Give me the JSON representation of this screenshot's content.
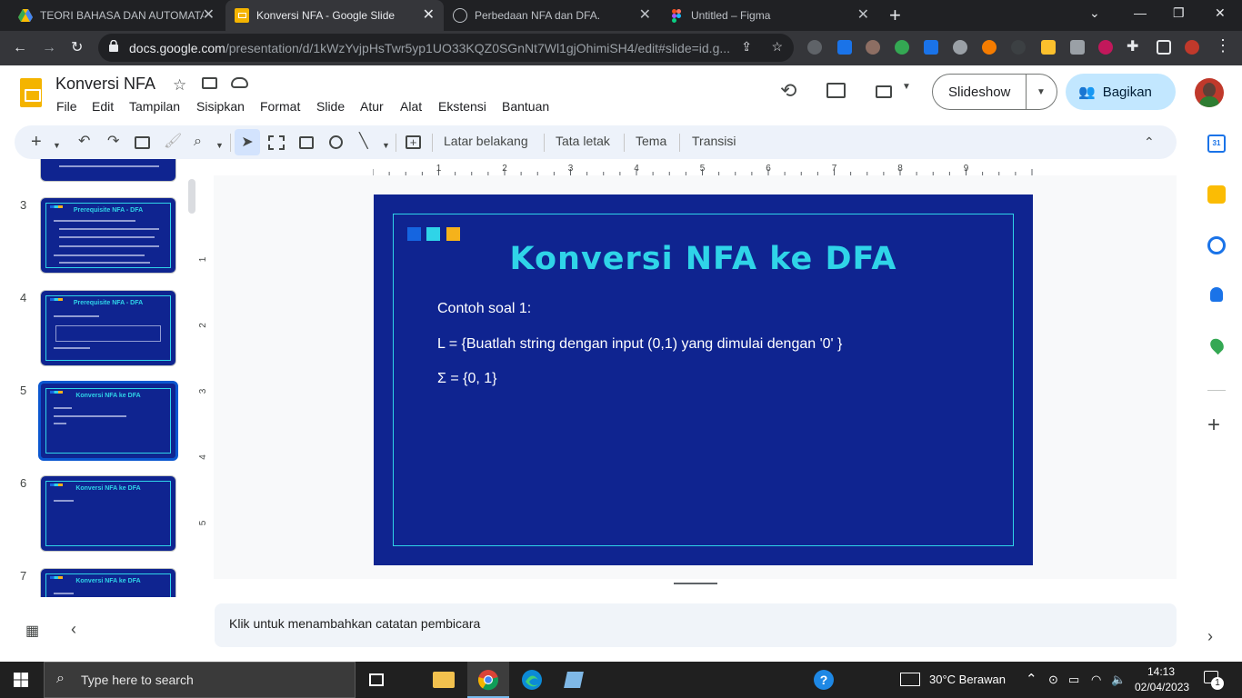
{
  "browser": {
    "tabs": [
      {
        "title": "TEORI BAHASA DAN AUTOMATA",
        "active": false
      },
      {
        "title": "Konversi NFA - Google Slide",
        "active": true
      },
      {
        "title": "Perbedaan NFA dan DFA.",
        "active": false
      },
      {
        "title": "Untitled – Figma",
        "active": false
      }
    ],
    "new_tab": "+",
    "url_host": "docs.google.com",
    "url_path": "/presentation/d/1kWzYvjpHsTwr5yp1UO33KQZ0SGnNt7Wl1gjOhimiSH4/edit#slide=id.g..."
  },
  "docs": {
    "title": "Konversi NFA",
    "menu": [
      "File",
      "Edit",
      "Tampilan",
      "Sisipkan",
      "Format",
      "Slide",
      "Atur",
      "Alat",
      "Ekstensi",
      "Bantuan"
    ],
    "slideshow_label": "Slideshow",
    "share_label": "Bagikan"
  },
  "toolbar": {
    "background_label": "Latar belakang",
    "layout_label": "Tata letak",
    "theme_label": "Tema",
    "transition_label": "Transisi"
  },
  "filmstrip": [
    {
      "num": "3",
      "title": "Prerequisite NFA - DFA"
    },
    {
      "num": "4",
      "title": "Prerequisite NFA - DFA"
    },
    {
      "num": "5",
      "title": "Konversi NFA ke DFA",
      "selected": true
    },
    {
      "num": "6",
      "title": "Konversi NFA ke DFA"
    },
    {
      "num": "7",
      "title": "Konversi NFA ke DFA"
    }
  ],
  "ruler": {
    "h": [
      "1",
      "2",
      "3",
      "4",
      "5",
      "6",
      "7",
      "8",
      "9"
    ],
    "v": [
      "1",
      "2",
      "3",
      "4",
      "5"
    ]
  },
  "slide": {
    "title": "Konversi NFA ke DFA",
    "lines": [
      "Contoh soal 1:",
      "L = {Buatlah string dengan input (0,1) yang dimulai dengan '0' }",
      "Σ = {0, 1}"
    ],
    "colors": {
      "background": "#0f2490",
      "accent": "#2fd4e8",
      "squares": [
        "#1565e0",
        "#2fd4e8",
        "#f5b21b"
      ]
    }
  },
  "notes_placeholder": "Klik untuk menambahkan catatan pembicara",
  "taskbar": {
    "search_placeholder": "Type here to search",
    "weather": "30°C  Berawan",
    "time": "14:13",
    "date": "02/04/2023",
    "notification_count": "1"
  }
}
